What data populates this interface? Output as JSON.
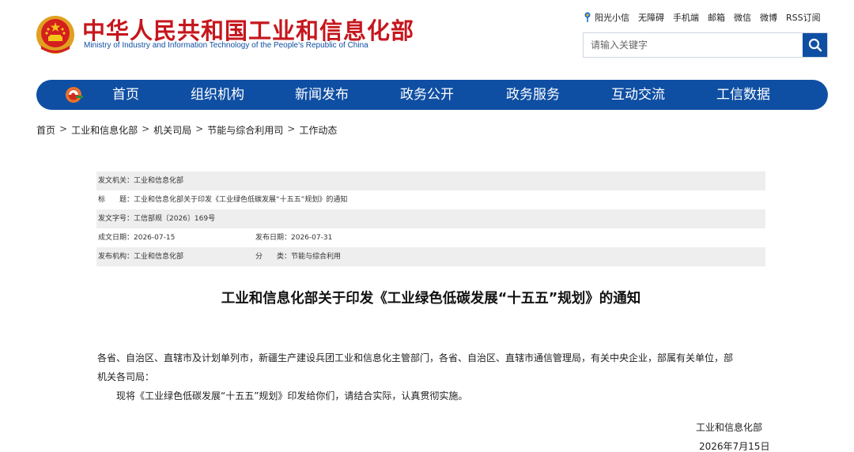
{
  "header": {
    "title_cn": "中华人民共和国工业和信息化部",
    "title_en": "Ministry of Industry and Information Technology of the People's Republic of China",
    "emblem_icon": "national-emblem-icon"
  },
  "toplinks": [
    "阳光小信",
    "无障碍",
    "手机端",
    "邮箱",
    "微信",
    "微博",
    "RSS订阅"
  ],
  "search": {
    "placeholder": "请输入关键字",
    "icon": "search-icon"
  },
  "nav": {
    "logo_icon": "ministry-logo-icon",
    "items": [
      "首页",
      "组织机构",
      "新闻发布",
      "政务公开",
      "政务服务",
      "互动交流",
      "工信数据"
    ]
  },
  "breadcrumb": [
    "首页",
    "工业和信息化部",
    "机关司局",
    "节能与综合利用司",
    "工作动态"
  ],
  "meta": {
    "issuer": "发文机关：工业和信息化部",
    "title": "标　　题：工业和信息化部关于印发《工业绿色低碳发展“十五五”规划》的通知",
    "doc_number": "发文字号：工信部规〔2026〕169号",
    "created_date": "成文日期：2026-07-15",
    "published_date": "发布日期：2026-07-31",
    "publisher": "发布机构：工业和信息化部",
    "category": "分　　类：节能与综合利用"
  },
  "document": {
    "title": "工业和信息化部关于印发《工业绿色低碳发展“十五五”规划》的通知",
    "recipients_line1": "各省、自治区、直辖市及计划单列市，新疆生产建设兵团工业和信息化主管部门，各省、自治区、直辖市通信管理局，有关中央企业，部属有关单位，部",
    "recipients_line2": "机关各司局：",
    "body": "现将《工业绿色低碳发展“十五五”规划》印发给你们，请结合实际，认真贯彻实施。",
    "signature_org": "工业和信息化部",
    "signature_date": "2026年7月15日"
  },
  "colors": {
    "brand_blue": "#0f4fa3",
    "brand_red": "#c6161d",
    "meta_shade": "#eeeeee"
  }
}
